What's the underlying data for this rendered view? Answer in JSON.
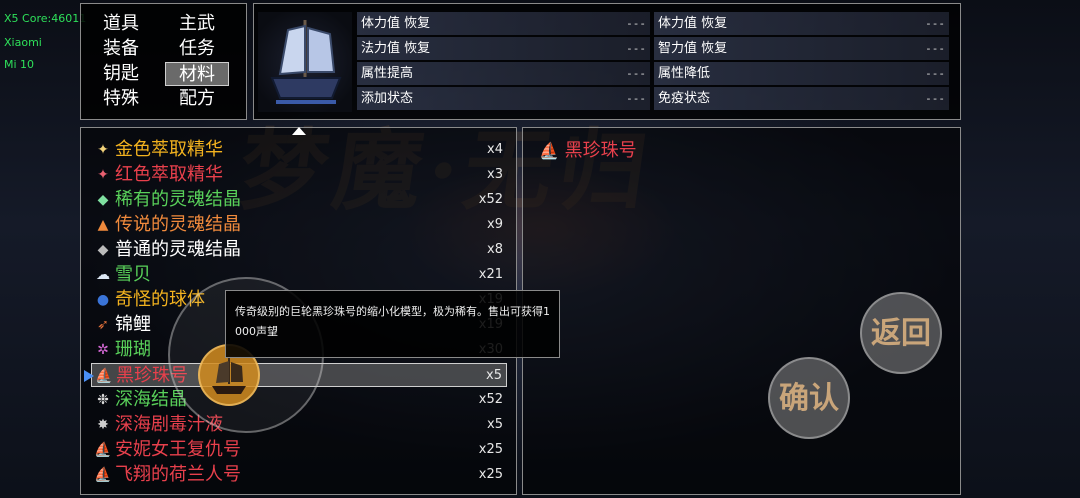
{
  "debug": {
    "core": "X5 Core:46011",
    "brand": "Xiaomi",
    "model": "Mi 10"
  },
  "categories": [
    {
      "label": "道具",
      "selected": false
    },
    {
      "label": "主武",
      "selected": false
    },
    {
      "label": "装备",
      "selected": false
    },
    {
      "label": "任务",
      "selected": false
    },
    {
      "label": "钥匙",
      "selected": false
    },
    {
      "label": "材料",
      "selected": true
    },
    {
      "label": "特殊",
      "selected": false
    },
    {
      "label": "配方",
      "selected": false
    }
  ],
  "stats": [
    {
      "label": "体力值  恢复",
      "value": "---"
    },
    {
      "label": "体力值  恢复",
      "value": "---"
    },
    {
      "label": "法力值  恢复",
      "value": "---"
    },
    {
      "label": "智力值  恢复",
      "value": "---"
    },
    {
      "label": "属性提高",
      "value": "---"
    },
    {
      "label": "属性降低",
      "value": "---"
    },
    {
      "label": "添加状态",
      "value": "---"
    },
    {
      "label": "免疫状态",
      "value": "---"
    }
  ],
  "items": [
    {
      "name": "金色萃取精华",
      "qty": "x4",
      "color": "#f2b21f",
      "icon": "golden-essence-icon",
      "glyph": "✦",
      "glyph_color": "#f2d27a"
    },
    {
      "name": "红色萃取精华",
      "qty": "x3",
      "color": "#e8404c",
      "icon": "red-essence-icon",
      "glyph": "✦",
      "glyph_color": "#e86070"
    },
    {
      "name": "稀有的灵魂结晶",
      "qty": "x52",
      "color": "#59d15a",
      "icon": "green-crystal-icon",
      "glyph": "◆",
      "glyph_color": "#7fe0a0"
    },
    {
      "name": "传说的灵魂结晶",
      "qty": "x9",
      "color": "#f08a3c",
      "icon": "orange-crystal-icon",
      "glyph": "▲",
      "glyph_color": "#f08a3c"
    },
    {
      "name": "普通的灵魂结晶",
      "qty": "x8",
      "color": "#ffffff",
      "icon": "gray-crystal-icon",
      "glyph": "◆",
      "glyph_color": "#bbbbbb"
    },
    {
      "name": "雪贝",
      "qty": "x21",
      "color": "#59d15a",
      "icon": "snow-shell-icon",
      "glyph": "☁",
      "glyph_color": "#dde8f5"
    },
    {
      "name": "奇怪的球体",
      "qty": "x19",
      "color": "#f2b21f",
      "icon": "strange-orb-icon",
      "glyph": "●",
      "glyph_color": "#3a74d8"
    },
    {
      "name": "锦鲤",
      "qty": "x19",
      "color": "#ffffff",
      "icon": "koi-icon",
      "glyph": "➶",
      "glyph_color": "#e0703a"
    },
    {
      "name": "珊瑚",
      "qty": "x30",
      "color": "#59d15a",
      "icon": "coral-icon",
      "glyph": "✲",
      "glyph_color": "#d86ad8"
    },
    {
      "name": "黑珍珠号",
      "qty": "x5",
      "color": "#e8404c",
      "icon": "ship-icon",
      "glyph": "⛵",
      "glyph_color": "#c8d4ee",
      "selected": true
    },
    {
      "name": "深海结晶",
      "qty": "x52",
      "color": "#59d15a",
      "icon": "deep-sea-crystal-icon",
      "glyph": "❉",
      "glyph_color": "#dddddd"
    },
    {
      "name": "深海剧毒汁液",
      "qty": "x5",
      "color": "#e8404c",
      "icon": "poison-icon",
      "glyph": "✸",
      "glyph_color": "#cccccc"
    },
    {
      "name": "安妮女王复仇号",
      "qty": "x25",
      "color": "#e8404c",
      "icon": "ship-icon",
      "glyph": "⛵",
      "glyph_color": "#d9a07a"
    },
    {
      "name": "飞翔的荷兰人号",
      "qty": "x25",
      "color": "#e8404c",
      "icon": "ship-icon",
      "glyph": "⛵",
      "glyph_color": "#d9a07a"
    }
  ],
  "detail": {
    "title": "黑珍珠号",
    "title_color": "#e8404c",
    "icon": "ship-icon"
  },
  "tooltip": {
    "line1": "传奇级别的巨轮黑珍珠号的缩小化模型，极为稀有。售出可获得1",
    "line2": "000声望"
  },
  "buttons": {
    "back": "返回",
    "confirm": "确认"
  }
}
